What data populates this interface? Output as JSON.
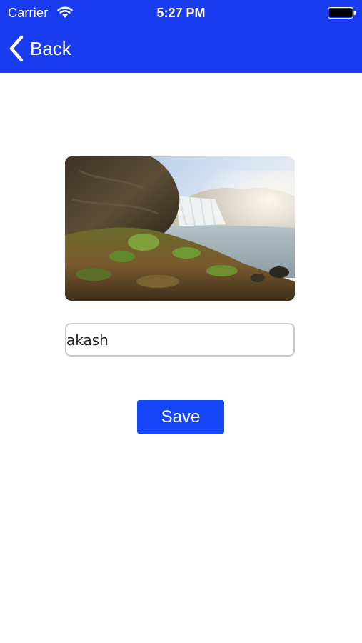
{
  "status_bar": {
    "carrier": "Carrier",
    "time": "5:27 PM",
    "wifi_icon": "wifi-icon",
    "battery_icon": "battery-icon"
  },
  "nav": {
    "back_label": "Back",
    "back_icon": "chevron-left-icon",
    "bar_color": "#1a3cf0"
  },
  "photo": {
    "alt": "waterfall landscape photo"
  },
  "name_field": {
    "value": "akash"
  },
  "actions": {
    "save_label": "Save",
    "save_color": "#1246f7"
  }
}
